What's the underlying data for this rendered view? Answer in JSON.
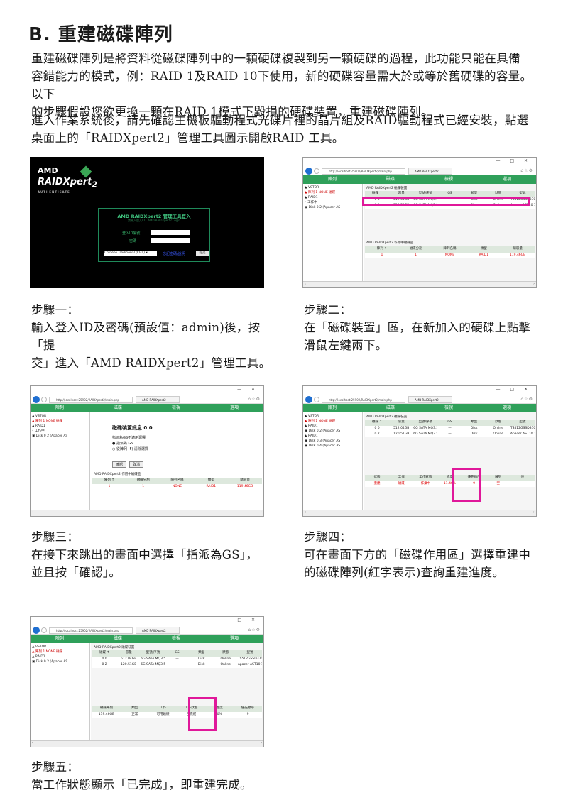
{
  "heading": "B. 重建磁碟陣列",
  "intro_lines": [
    "重建磁碟陣列是將資料從磁碟陣列中的一顆硬碟複製到另一顆硬碟的過程，此功能只能在具備",
    "容錯能力的模式，例：RAID 1及RAID 10下使用，新的硬碟容量需大於或等於舊硬碟的容量。以下",
    "的步驟假設您欲更換一顆在RAID 1模式下毀損的硬碟裝置，重建磁碟陣列。"
  ],
  "second_lines": [
    "進入作業系統後，請先確認主機板驅動程式光碟片裡的晶片組及RAID驅動程式已經安裝，點選",
    "桌面上的「RAIDXpert2」管理工具圖示開啟RAID 工具。"
  ],
  "steps": [
    {
      "label": "步驟一：",
      "lines": [
        "輸入登入ID及密碼(預設值：admin)後，按「提",
        "交」進入「AMD RAIDXpert2」管理工具。"
      ]
    },
    {
      "label": "步驟二：",
      "lines": [
        "在「磁碟裝置」區，在新加入的硬碟上點擊",
        "滑鼠左鍵兩下。"
      ]
    },
    {
      "label": "步驟三：",
      "lines": [
        "在接下來跳出的畫面中選擇「指派為GS」，",
        "並且按「確認」。"
      ]
    },
    {
      "label": "步驟四：",
      "lines": [
        "可在畫面下方的「磁碟作用區」選擇重建中",
        "的磁碟陣列(紅字表示)查詢重建進度。"
      ]
    },
    {
      "label": "步驟五：",
      "lines": [
        "當工作狀態顯示「已完成」，即重建完成。"
      ]
    }
  ],
  "login": {
    "brand_top": "AMD",
    "brand_name": "RAIDXpert",
    "brand_num": "2",
    "brand_tag": "AUTHENTICATE",
    "box_title": "AMD RAIDXpert2 管理工具登入",
    "box_sub": "請輸入登入ID：AMD RAIDXpert2 Login",
    "id_label": "登入ID帳號",
    "pw_label": "密碼",
    "language": "Chinese Traditional (CHT) ▾",
    "link": "忘記密碼/說明",
    "submit": "提交"
  },
  "browser": {
    "url": "http://localhost:25902/RAIDXpert2/main.php",
    "tab": "AMD RAIDXpert2",
    "menu": [
      "陣列",
      "磁碟",
      "檢視",
      "選項"
    ],
    "tree": [
      "▲ VSTOR",
      "  ▲ 陣列 1 NONE 磁碟",
      "    ▲ RAID1",
      "      • 工作中",
      "      ▣ Disk 0 2 (Apacer AS"
    ],
    "tree_extra": [
      "  ▲ RAID1",
      "    ▣ Disk 0 3 (Apacer AS",
      "    ▣ Disk 0 4 (Apacer AS"
    ]
  },
  "disk_table": {
    "title": "AMD RAIDXpert2 磁碟裝置",
    "headers": [
      "磁碟 ↑",
      "容量",
      "型號/序號",
      "GS",
      "類型",
      "狀態",
      "型號"
    ],
    "rows": [
      [
        "0 0",
        "512.04GB",
        "6G SATA MQ3.550",
        "—",
        "Disk",
        "Online",
        "TS512GSSD370S"
      ],
      [
        "0 2",
        "120.51GB",
        "6G SATA MQ3.550",
        "—",
        "Disk",
        "Online",
        "Apacer AST10 128G"
      ]
    ]
  },
  "task_table": {
    "title": "AMD RAIDXpert2 作用中磁碟區",
    "headers": [
      "陣列 ↑",
      "磁碟分割",
      "陣列名稱",
      "類型",
      "總容量"
    ],
    "row": [
      "1",
      "1",
      "NONE",
      "RAID1",
      "119.46GB"
    ]
  },
  "dialog": {
    "title": "磁碟裝置訊息 0 0",
    "opt1": "指派為GS不適用選擇",
    "opt2": "● 指派為 GS",
    "opt3": "○ 從陣列 (F) 清除選擇",
    "ok": "確認",
    "cancel": "取消"
  },
  "progress_table": {
    "headers": [
      "狀態",
      "工作",
      "工作狀態",
      "進度",
      "優先順序",
      "陣列",
      "停"
    ],
    "row": [
      "重建",
      "磁碟",
      "作業中",
      "11.46%",
      "9",
      "空",
      ""
    ]
  },
  "done_table": {
    "headers": [
      "磁碟陣列",
      "類型",
      "工作",
      "工作狀態",
      "進度",
      "優先順序"
    ],
    "row": [
      "119.46GB",
      "正常",
      "可用磁碟",
      "已完成",
      "0%",
      "9"
    ]
  }
}
